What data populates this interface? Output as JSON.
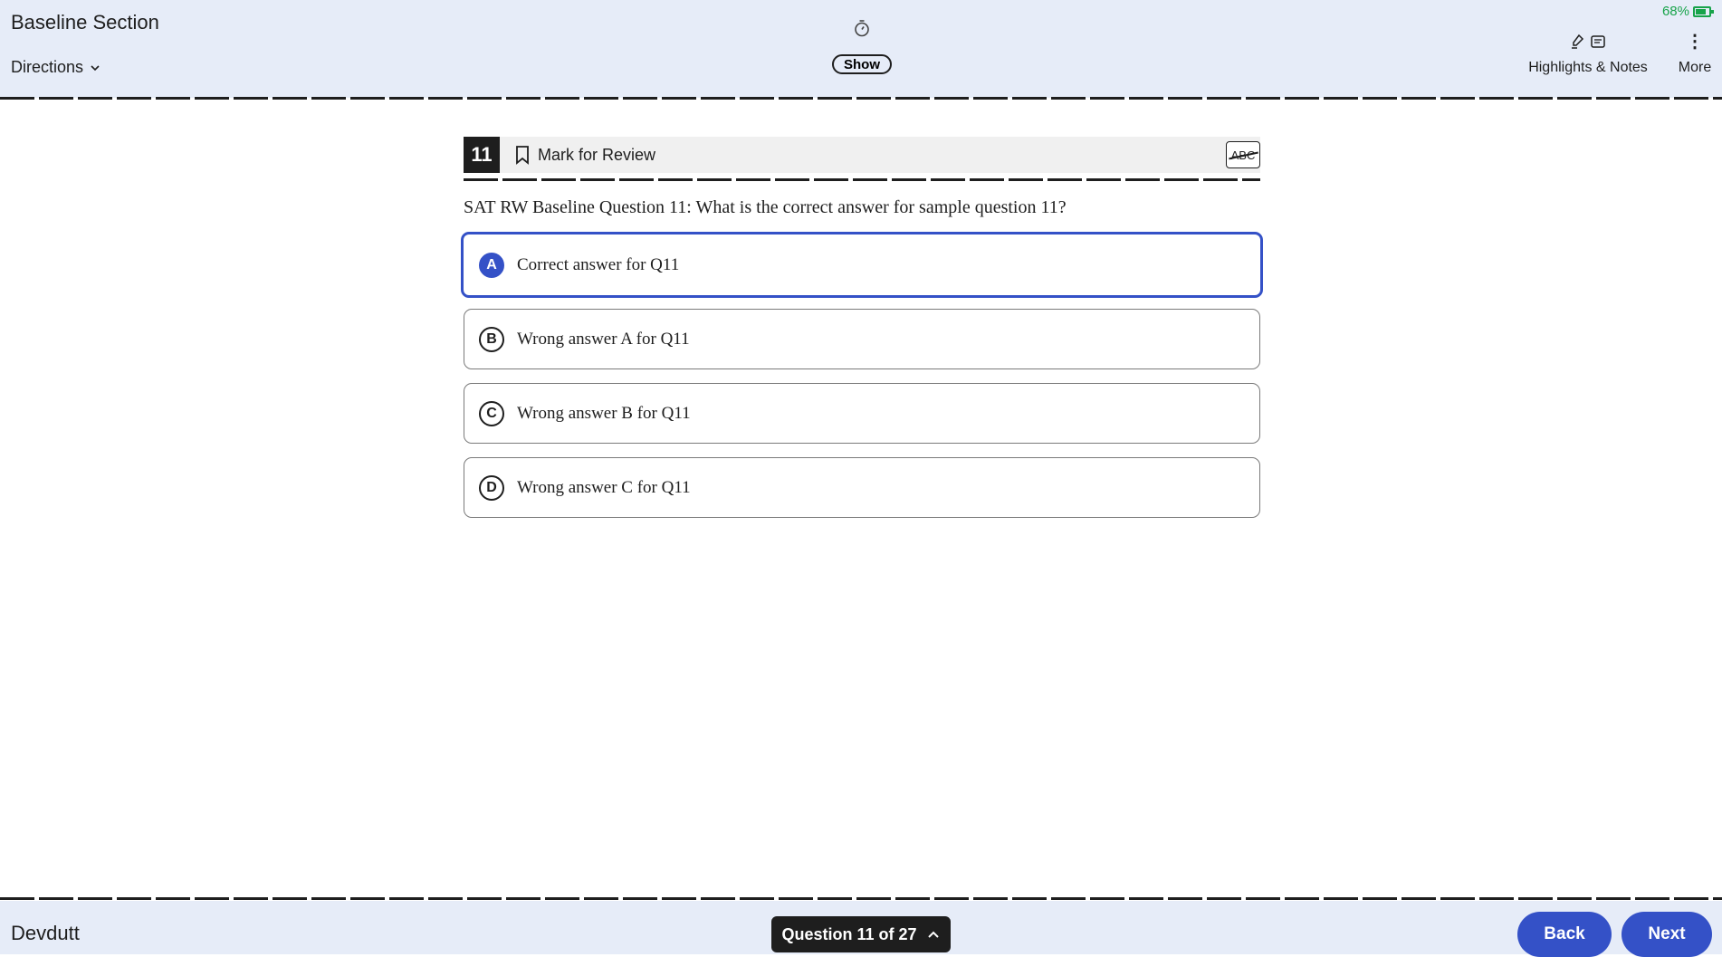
{
  "header": {
    "section_title": "Baseline Section",
    "directions_label": "Directions",
    "timer_toggle_label": "Show",
    "battery_percent": "68%",
    "battery_level": 0.68,
    "highlights_notes_label": "Highlights & Notes",
    "more_label": "More"
  },
  "question": {
    "number": "11",
    "mark_for_review_label": "Mark for Review",
    "eliminator_label": "ABC",
    "text": "SAT RW Baseline Question 11: What is the correct answer for sample question 11?",
    "options": [
      {
        "letter": "A",
        "text": "Correct answer for Q11",
        "selected": true
      },
      {
        "letter": "B",
        "text": "Wrong answer A for Q11",
        "selected": false
      },
      {
        "letter": "C",
        "text": "Wrong answer B for Q11",
        "selected": false
      },
      {
        "letter": "D",
        "text": "Wrong answer C for Q11",
        "selected": false
      }
    ]
  },
  "footer": {
    "user_name": "Devdutt",
    "question_nav_label": "Question 11 of 27",
    "back_label": "Back",
    "next_label": "Next"
  },
  "colors": {
    "accent": "#3451c7",
    "header_bg": "#e6ecf8",
    "battery": "#17a34a"
  }
}
